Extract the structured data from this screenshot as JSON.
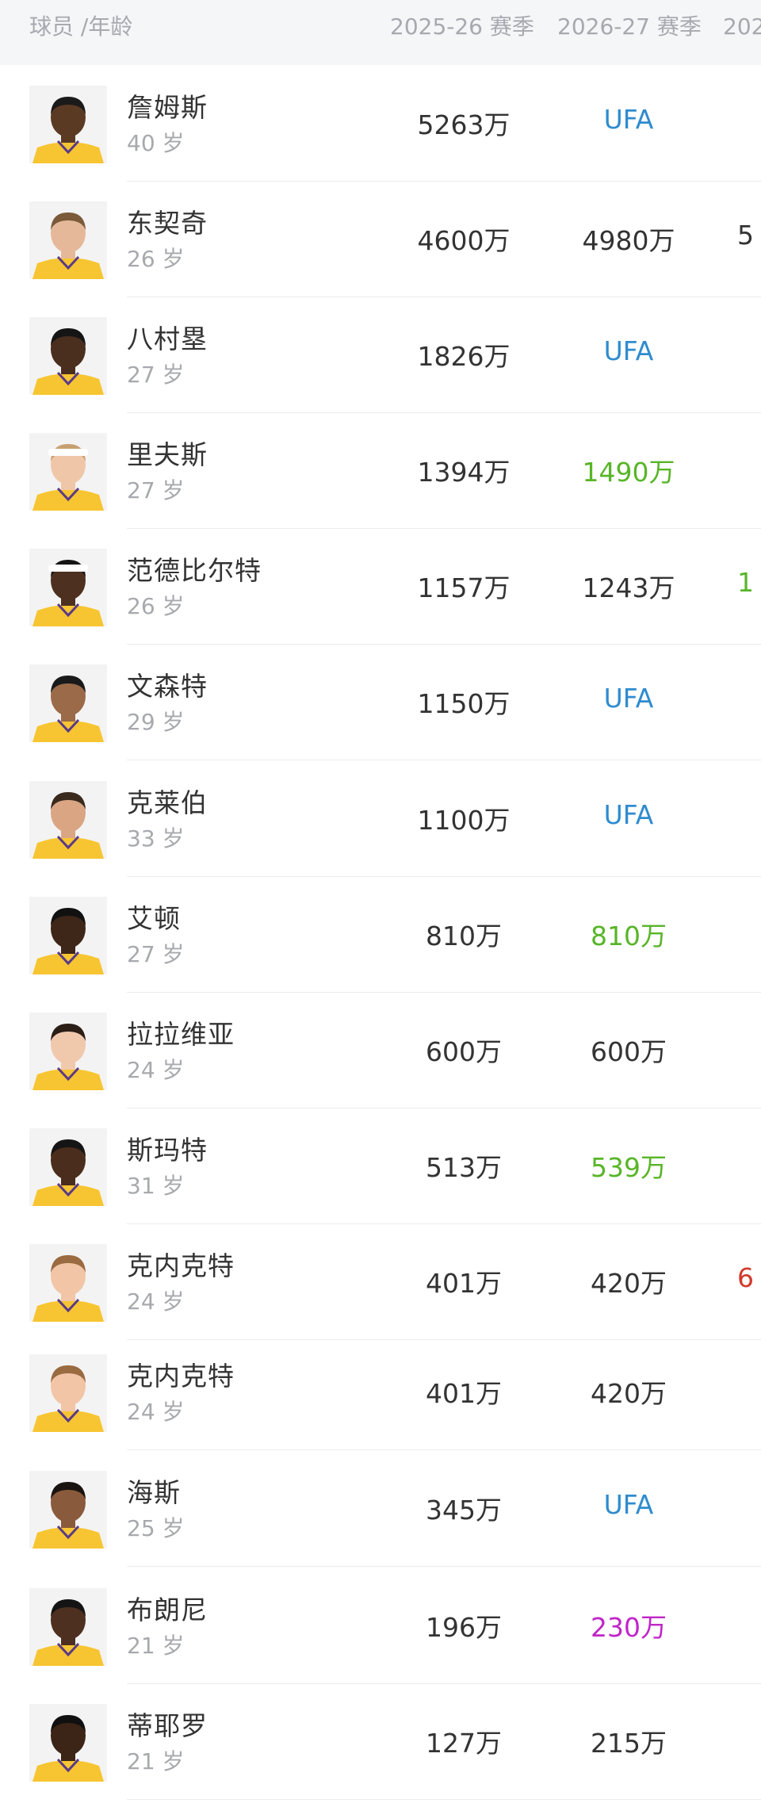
{
  "header": {
    "player_age": "球员 /年龄",
    "season1": "2025-26 赛季",
    "season2": "2026-27 赛季",
    "season3": "202"
  },
  "colors": {
    "default": "#333333",
    "ufa": "#2f8ccf",
    "green": "#58b528",
    "purple": "#c025c8",
    "red": "#d13a2c",
    "jersey": "#f7c531"
  },
  "players": [
    {
      "name": "詹姆斯",
      "age": "40 岁",
      "s1": "5263万",
      "s2": "UFA",
      "s2_style": "ufa",
      "s3": "",
      "s3_style": "default",
      "skin": "#5b3a24",
      "hair": "#1a1a1a",
      "band": ""
    },
    {
      "name": "东契奇",
      "age": "26 岁",
      "s1": "4600万",
      "s2": "4980万",
      "s2_style": "default",
      "s3": "5",
      "s3_style": "default",
      "skin": "#e6b89a",
      "hair": "#7a5a3a",
      "band": ""
    },
    {
      "name": "八村塁",
      "age": "27 岁",
      "s1": "1826万",
      "s2": "UFA",
      "s2_style": "ufa",
      "s3": "",
      "s3_style": "default",
      "skin": "#4a2e1e",
      "hair": "#151515",
      "band": ""
    },
    {
      "name": "里夫斯",
      "age": "27 岁",
      "s1": "1394万",
      "s2": "1490万",
      "s2_style": "green",
      "s3": "",
      "s3_style": "default",
      "skin": "#efc7a8",
      "hair": "#c8a070",
      "band": "#ffffff"
    },
    {
      "name": "范德比尔特",
      "age": "26 岁",
      "s1": "1157万",
      "s2": "1243万",
      "s2_style": "default",
      "s3": "1",
      "s3_style": "green",
      "skin": "#4d301f",
      "hair": "#151515",
      "band": "#ffffff"
    },
    {
      "name": "文森特",
      "age": "29 岁",
      "s1": "1150万",
      "s2": "UFA",
      "s2_style": "ufa",
      "s3": "",
      "s3_style": "default",
      "skin": "#9b6a48",
      "hair": "#1a1a1a",
      "band": ""
    },
    {
      "name": "克莱伯",
      "age": "33 岁",
      "s1": "1100万",
      "s2": "UFA",
      "s2_style": "ufa",
      "s3": "",
      "s3_style": "default",
      "skin": "#d9a583",
      "hair": "#3a2a1e",
      "band": ""
    },
    {
      "name": "艾顿",
      "age": "27 岁",
      "s1": "810万",
      "s2": "810万",
      "s2_style": "green",
      "s3": "",
      "s3_style": "default",
      "skin": "#3e2618",
      "hair": "#111111",
      "band": ""
    },
    {
      "name": "拉拉维亚",
      "age": "24 岁",
      "s1": "600万",
      "s2": "600万",
      "s2_style": "default",
      "s3": "",
      "s3_style": "default",
      "skin": "#f0c9ad",
      "hair": "#2a1e16",
      "band": ""
    },
    {
      "name": "斯玛特",
      "age": "31 岁",
      "s1": "513万",
      "s2": "539万",
      "s2_style": "green",
      "s3": "",
      "s3_style": "default",
      "skin": "#4a2d1c",
      "hair": "#151515",
      "band": ""
    },
    {
      "name": "克内克特",
      "age": "24 岁",
      "s1": "401万",
      "s2": "420万",
      "s2_style": "default",
      "s3": "6",
      "s3_style": "red",
      "skin": "#f1c5a6",
      "hair": "#9a6a40",
      "band": ""
    },
    {
      "name": "克内克特",
      "age": "24 岁",
      "s1": "401万",
      "s2": "420万",
      "s2_style": "default",
      "s3": "",
      "s3_style": "default",
      "skin": "#f1c5a6",
      "hair": "#9a6a40",
      "band": ""
    },
    {
      "name": "海斯",
      "age": "25 岁",
      "s1": "345万",
      "s2": "UFA",
      "s2_style": "ufa",
      "s3": "",
      "s3_style": "default",
      "skin": "#8a5a3c",
      "hair": "#1a1410",
      "band": ""
    },
    {
      "name": "布朗尼",
      "age": "21 岁",
      "s1": "196万",
      "s2": "230万",
      "s2_style": "purple",
      "s3": "",
      "s3_style": "default",
      "skin": "#4e3020",
      "hair": "#141414",
      "band": ""
    },
    {
      "name": "蒂耶罗",
      "age": "21 岁",
      "s1": "127万",
      "s2": "215万",
      "s2_style": "default",
      "s3": "",
      "s3_style": "default",
      "skin": "#3c2416",
      "hair": "#101010",
      "band": ""
    }
  ]
}
